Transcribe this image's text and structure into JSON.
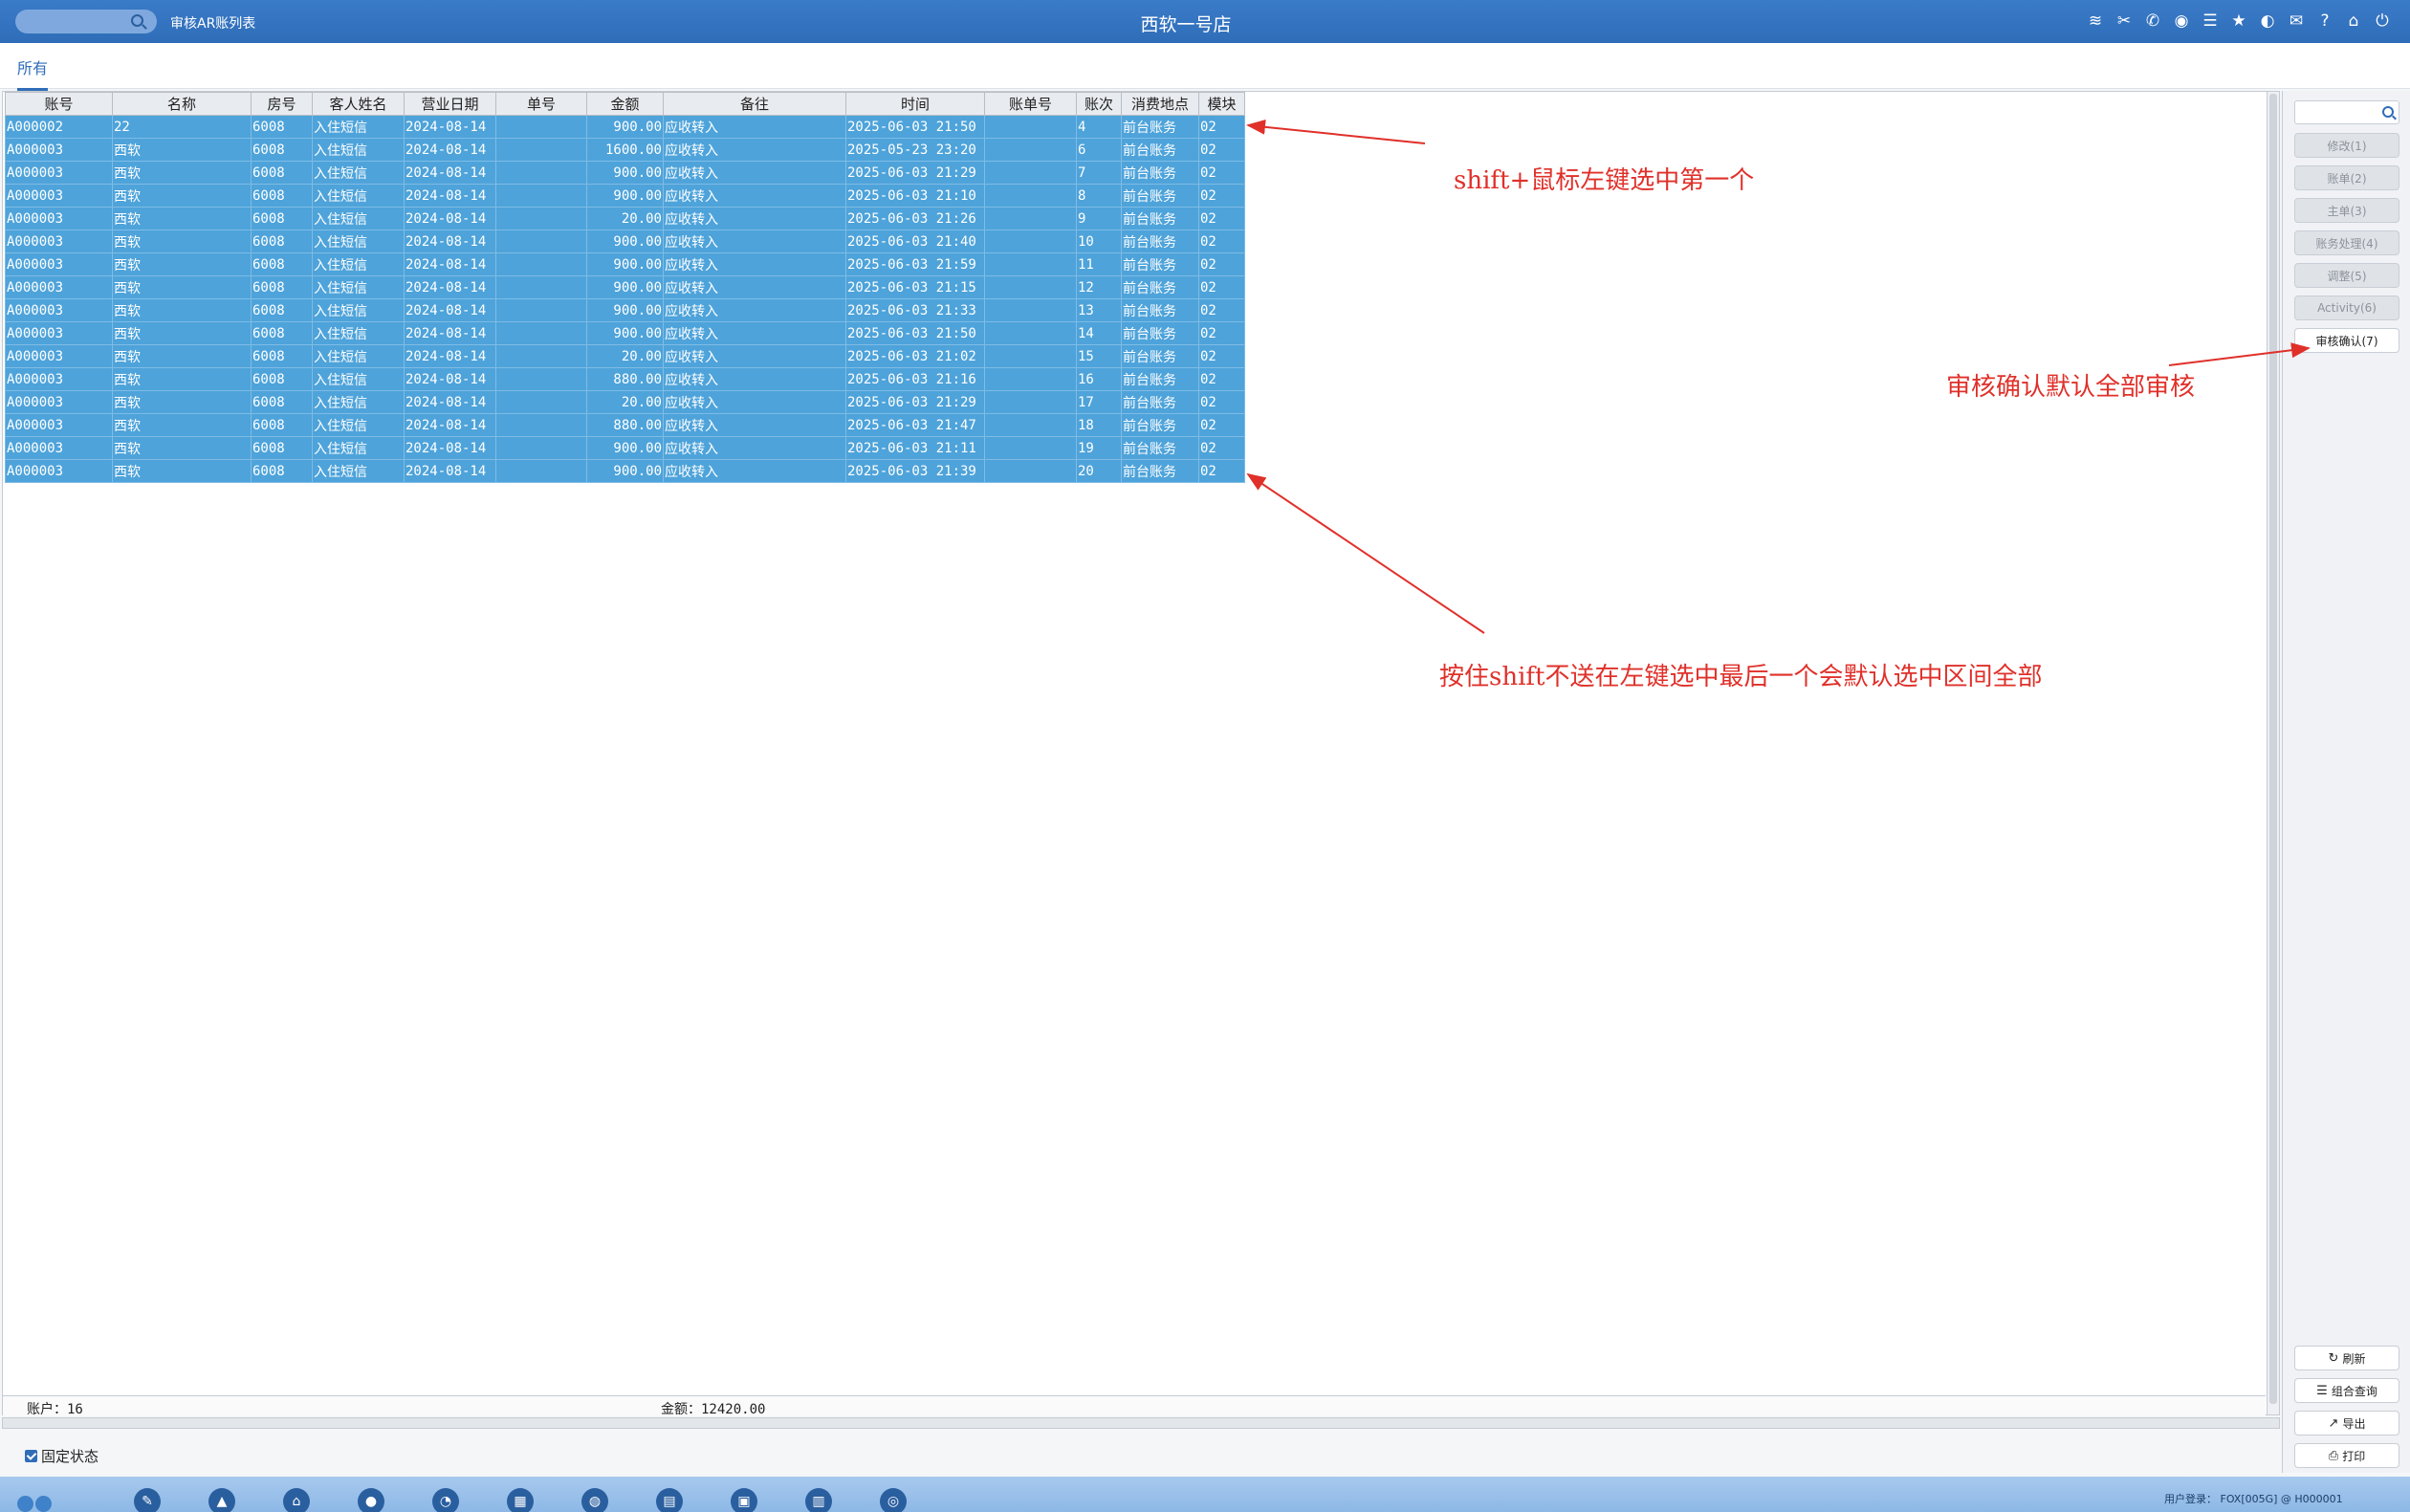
{
  "titlebar": {
    "page_label": "审核AR账列表",
    "app_title": "西软一号店",
    "icons": [
      "wifi-icon",
      "tools-icon",
      "phone-icon",
      "palette-icon",
      "menu-icon",
      "star-icon",
      "theme-icon",
      "mail-icon",
      "help-icon",
      "home-icon",
      "power-icon"
    ]
  },
  "tabs": {
    "all": "所有"
  },
  "table": {
    "columns": [
      "账号",
      "名称",
      "房号",
      "客人姓名",
      "营业日期",
      "单号",
      "金额",
      "备往",
      "时间",
      "账单号",
      "账次",
      "消费地点",
      "模块"
    ],
    "rows": [
      [
        "A000002",
        "22",
        "6008",
        "入住短信",
        "2024-08-14",
        "",
        "900.00",
        "应收转入",
        "2025-06-03 21:50",
        "",
        "4",
        "前台账务",
        "02"
      ],
      [
        "A000003",
        "西软",
        "6008",
        "入住短信",
        "2024-08-14",
        "",
        "1600.00",
        "应收转入",
        "2025-05-23 23:20",
        "",
        "6",
        "前台账务",
        "02"
      ],
      [
        "A000003",
        "西软",
        "6008",
        "入住短信",
        "2024-08-14",
        "",
        "900.00",
        "应收转入",
        "2025-06-03 21:29",
        "",
        "7",
        "前台账务",
        "02"
      ],
      [
        "A000003",
        "西软",
        "6008",
        "入住短信",
        "2024-08-14",
        "",
        "900.00",
        "应收转入",
        "2025-06-03 21:10",
        "",
        "8",
        "前台账务",
        "02"
      ],
      [
        "A000003",
        "西软",
        "6008",
        "入住短信",
        "2024-08-14",
        "",
        "20.00",
        "应收转入",
        "2025-06-03 21:26",
        "",
        "9",
        "前台账务",
        "02"
      ],
      [
        "A000003",
        "西软",
        "6008",
        "入住短信",
        "2024-08-14",
        "",
        "900.00",
        "应收转入",
        "2025-06-03 21:40",
        "",
        "10",
        "前台账务",
        "02"
      ],
      [
        "A000003",
        "西软",
        "6008",
        "入住短信",
        "2024-08-14",
        "",
        "900.00",
        "应收转入",
        "2025-06-03 21:59",
        "",
        "11",
        "前台账务",
        "02"
      ],
      [
        "A000003",
        "西软",
        "6008",
        "入住短信",
        "2024-08-14",
        "",
        "900.00",
        "应收转入",
        "2025-06-03 21:15",
        "",
        "12",
        "前台账务",
        "02"
      ],
      [
        "A000003",
        "西软",
        "6008",
        "入住短信",
        "2024-08-14",
        "",
        "900.00",
        "应收转入",
        "2025-06-03 21:33",
        "",
        "13",
        "前台账务",
        "02"
      ],
      [
        "A000003",
        "西软",
        "6008",
        "入住短信",
        "2024-08-14",
        "",
        "900.00",
        "应收转入",
        "2025-06-03 21:50",
        "",
        "14",
        "前台账务",
        "02"
      ],
      [
        "A000003",
        "西软",
        "6008",
        "入住短信",
        "2024-08-14",
        "",
        "20.00",
        "应收转入",
        "2025-06-03 21:02",
        "",
        "15",
        "前台账务",
        "02"
      ],
      [
        "A000003",
        "西软",
        "6008",
        "入住短信",
        "2024-08-14",
        "",
        "880.00",
        "应收转入",
        "2025-06-03 21:16",
        "",
        "16",
        "前台账务",
        "02"
      ],
      [
        "A000003",
        "西软",
        "6008",
        "入住短信",
        "2024-08-14",
        "",
        "20.00",
        "应收转入",
        "2025-06-03 21:29",
        "",
        "17",
        "前台账务",
        "02"
      ],
      [
        "A000003",
        "西软",
        "6008",
        "入住短信",
        "2024-08-14",
        "",
        "880.00",
        "应收转入",
        "2025-06-03 21:47",
        "",
        "18",
        "前台账务",
        "02"
      ],
      [
        "A000003",
        "西软",
        "6008",
        "入住短信",
        "2024-08-14",
        "",
        "900.00",
        "应收转入",
        "2025-06-03 21:11",
        "",
        "19",
        "前台账务",
        "02"
      ],
      [
        "A000003",
        "西软",
        "6008",
        "入住短信",
        "2024-08-14",
        "",
        "900.00",
        "应收转入",
        "2025-06-03 21:39",
        "",
        "20",
        "前台账务",
        "02"
      ]
    ]
  },
  "footer": {
    "accounts": "账户：16",
    "amount": "金额：12420.00"
  },
  "fixed_status": "固定状态",
  "side_buttons": {
    "modify": "修改(1)",
    "bill": "账单(2)",
    "master": "主单(3)",
    "account_process": "账务处理(4)",
    "adjust": "调整(5)",
    "activity": "Activity(6)",
    "audit_confirm": "审核确认(7)",
    "refresh": "刷新",
    "combo_query": "组合查询",
    "export": "导出",
    "print": "打印"
  },
  "taskbar": {
    "user_login": "用户登录： FOX[005G] @ H000001"
  },
  "annotations": {
    "first": "shift+鼠标左键选中第一个",
    "audit": "审核确认默认全部审核",
    "last": "按住shift不送在左键选中最后一个会默认选中区间全部"
  },
  "colors": {
    "accent": "#2f6db8",
    "selected_row": "#4ea3da",
    "annotation": "#e0302a"
  }
}
